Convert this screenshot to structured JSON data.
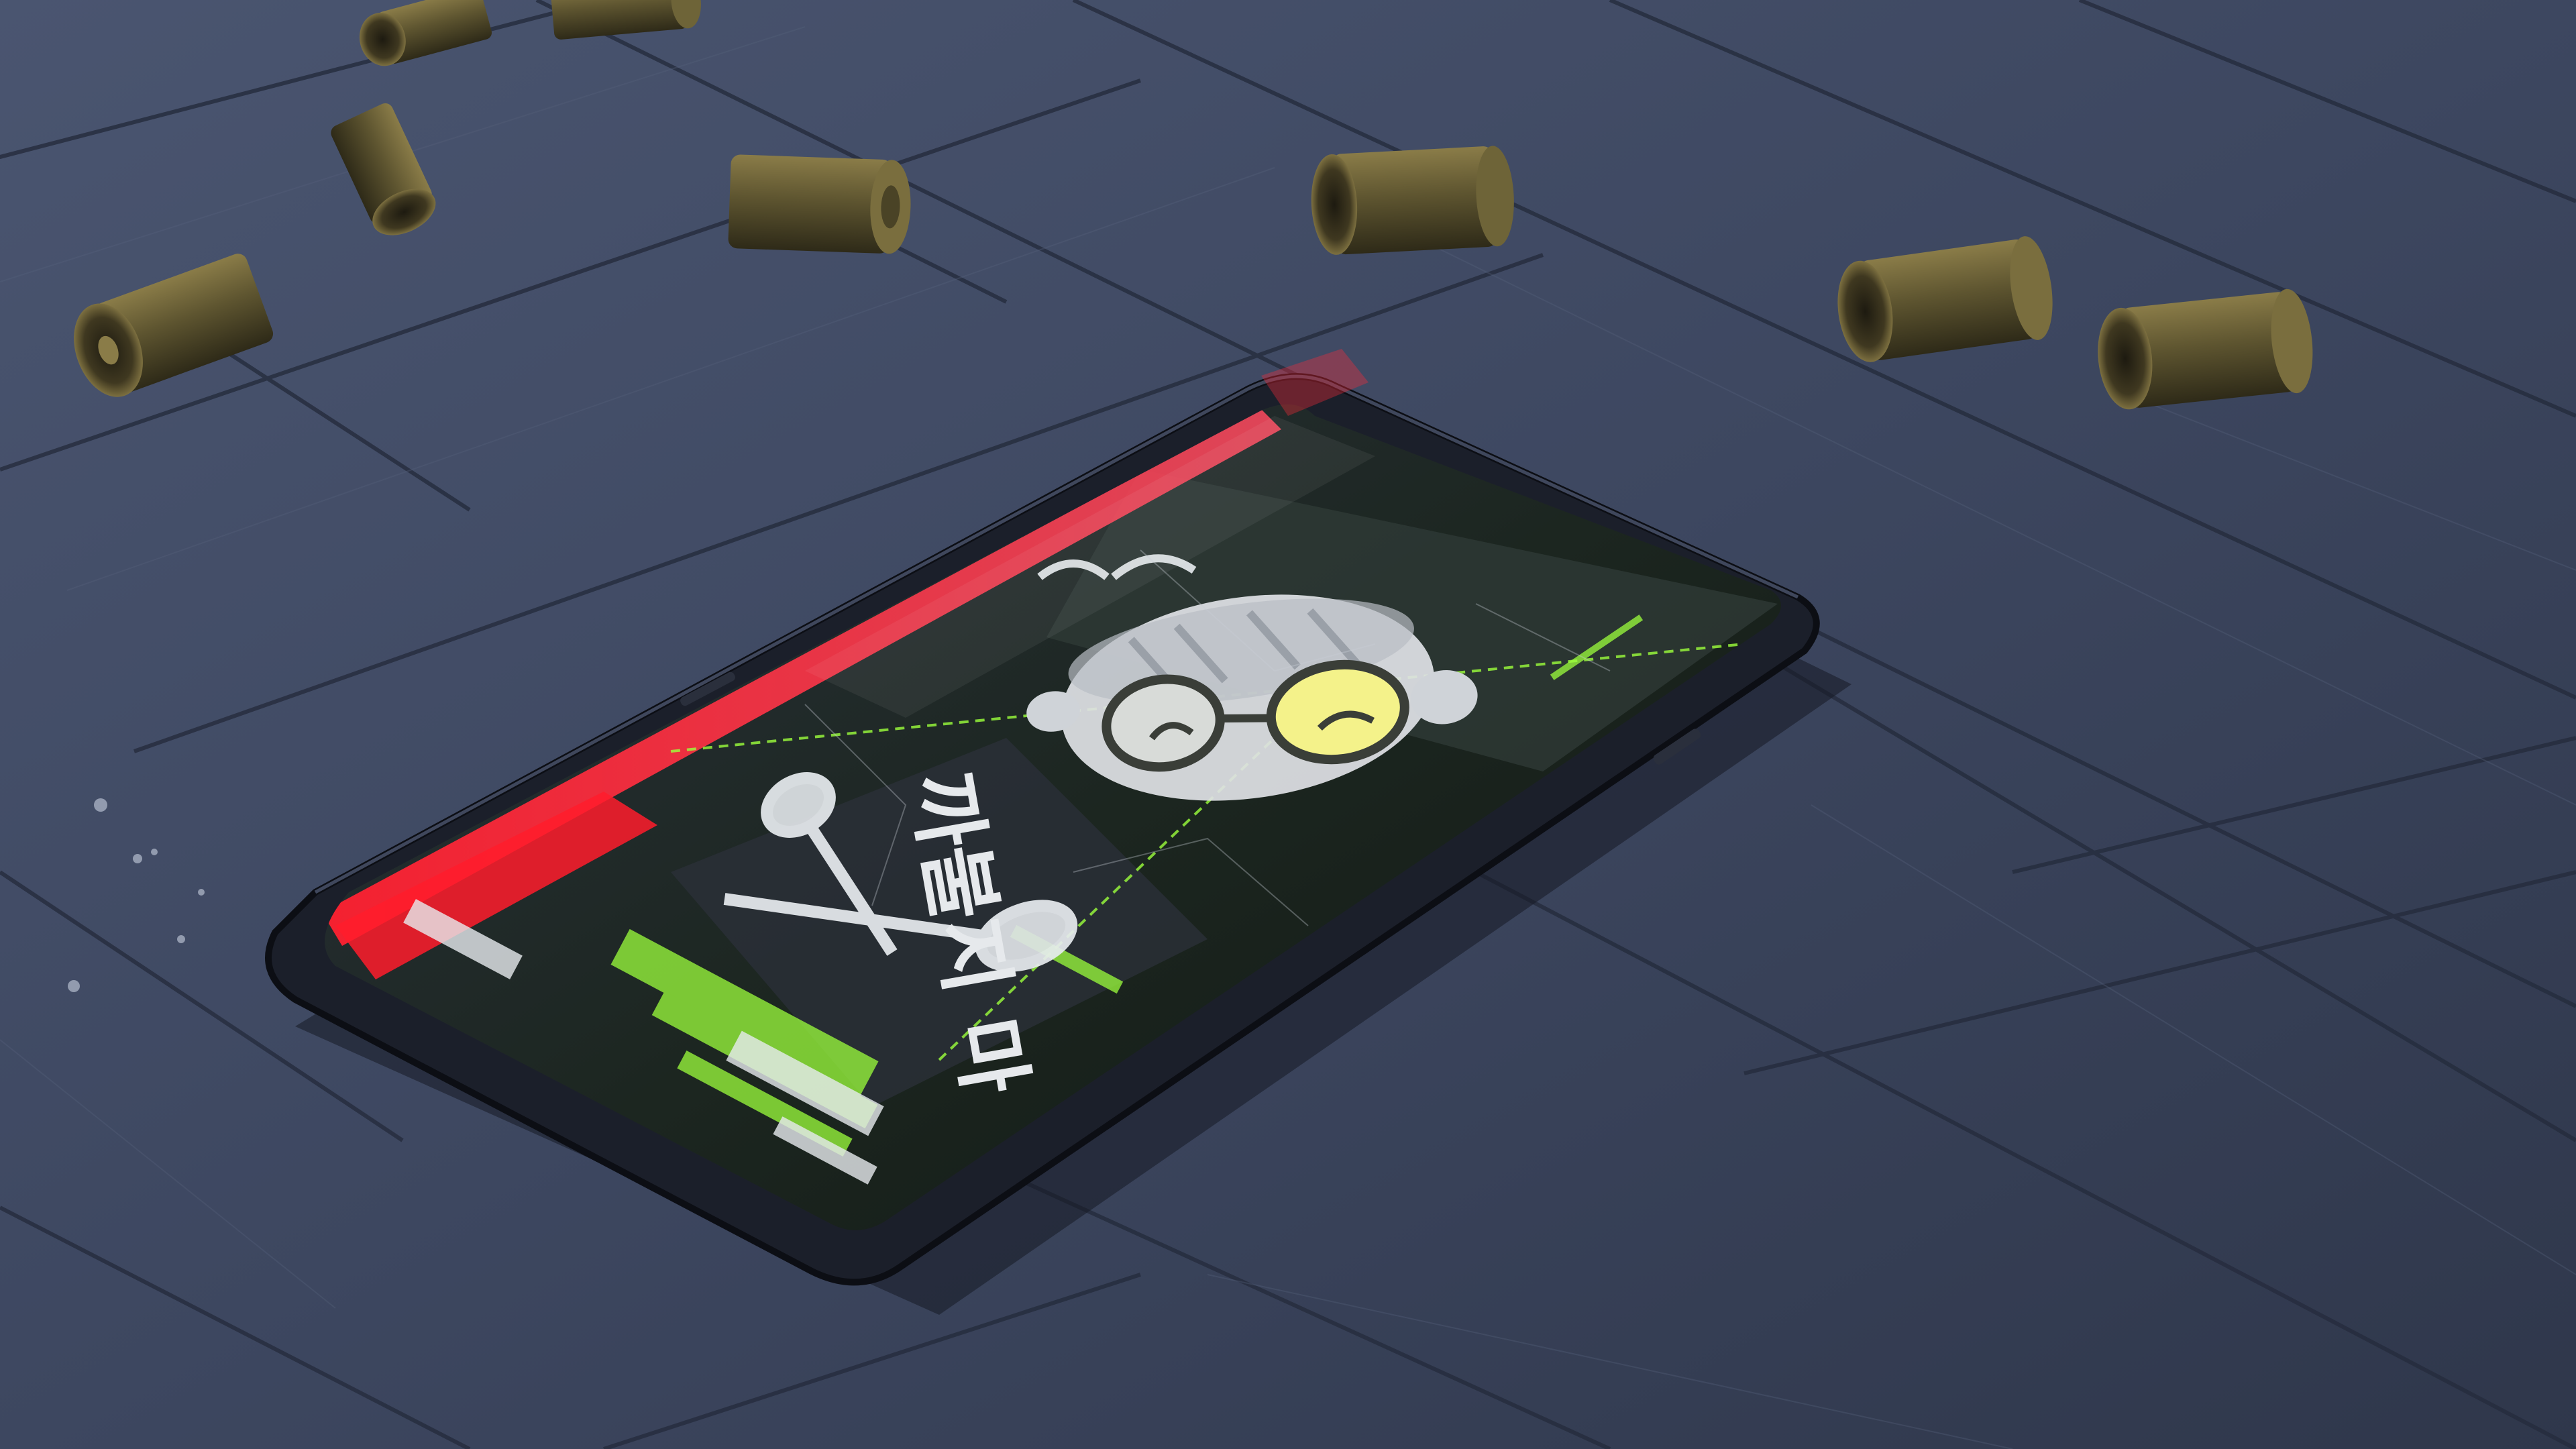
{
  "scene": {
    "description_free": true,
    "screen_text": "까불지 마",
    "colors": {
      "floor": "#3f4a62",
      "floor_dark": "#2b3346",
      "floor_seam": "#242b3c",
      "phone_body": "#1a1d27",
      "screen_bg": "#16221a",
      "glitch_red": "#ff2a3a",
      "glitch_green": "#9bff3a",
      "casing_brass": "#5a5230",
      "casing_highlight": "#a89a5a"
    },
    "icons": {
      "character": "character-face-icon",
      "weapons": "crossed-clubs-icon"
    }
  }
}
